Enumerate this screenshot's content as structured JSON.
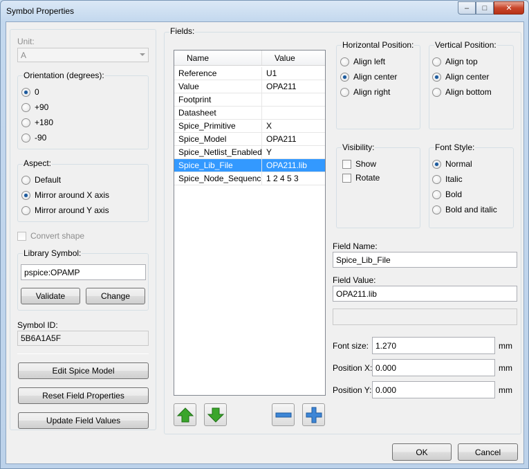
{
  "window": {
    "title": "Symbol Properties",
    "caption": {
      "minimize": "–",
      "maximize": "□",
      "close": "✕"
    }
  },
  "left": {
    "unit_label": "Unit:",
    "unit_value": "A",
    "orientation": {
      "title": "Orientation (degrees):",
      "options": [
        "0",
        "+90",
        "+180",
        "-90"
      ],
      "selected": 0
    },
    "aspect": {
      "title": "Aspect:",
      "options": [
        "Default",
        "Mirror around X axis",
        "Mirror around Y axis"
      ],
      "selected": 1
    },
    "convert_shape": "Convert shape",
    "library_symbol": {
      "title": "Library Symbol:",
      "value": "pspice:OPAMP",
      "validate": "Validate",
      "change": "Change"
    },
    "symbol_id_label": "Symbol ID:",
    "symbol_id_value": "5B6A1A5F",
    "edit_spice_model": "Edit Spice Model",
    "reset_field_properties": "Reset Field Properties",
    "update_field_values": "Update Field Values"
  },
  "fields": {
    "label": "Fields:",
    "columns": [
      "Name",
      "Value"
    ],
    "rows": [
      {
        "name": "Reference",
        "value": "U1"
      },
      {
        "name": "Value",
        "value": "OPA211"
      },
      {
        "name": "Footprint",
        "value": ""
      },
      {
        "name": "Datasheet",
        "value": ""
      },
      {
        "name": "Spice_Primitive",
        "value": "X"
      },
      {
        "name": "Spice_Model",
        "value": "OPA211"
      },
      {
        "name": "Spice_Netlist_Enabled",
        "value": "Y"
      },
      {
        "name": "Spice_Lib_File",
        "value": "OPA211.lib"
      },
      {
        "name": "Spice_Node_Sequence",
        "value": "1 2 4 5 3"
      }
    ],
    "selected_row": 7
  },
  "right": {
    "hpos": {
      "title": "Horizontal Position:",
      "options": [
        "Align left",
        "Align center",
        "Align right"
      ],
      "selected": 1
    },
    "vpos": {
      "title": "Vertical Position:",
      "options": [
        "Align top",
        "Align center",
        "Align bottom"
      ],
      "selected": 1
    },
    "visibility": {
      "title": "Visibility:",
      "show": "Show",
      "rotate": "Rotate"
    },
    "font_style": {
      "title": "Font Style:",
      "options": [
        "Normal",
        "Italic",
        "Bold",
        "Bold and italic"
      ],
      "selected": 0
    },
    "field_name_label": "Field Name:",
    "field_name_value": "Spice_Lib_File",
    "field_value_label": "Field Value:",
    "field_value_value": "OPA211.lib",
    "font_size_label": "Font size:",
    "font_size_value": "1.270",
    "pos_x_label": "Position X:",
    "pos_x_value": "0.000",
    "pos_y_label": "Position Y:",
    "pos_y_value": "0.000",
    "unit": "mm"
  },
  "footer": {
    "ok": "OK",
    "cancel": "Cancel"
  },
  "colors": {
    "selection": "#3399ff",
    "arrow_green": "#3aa52b",
    "plus_blue": "#3d86d6"
  }
}
